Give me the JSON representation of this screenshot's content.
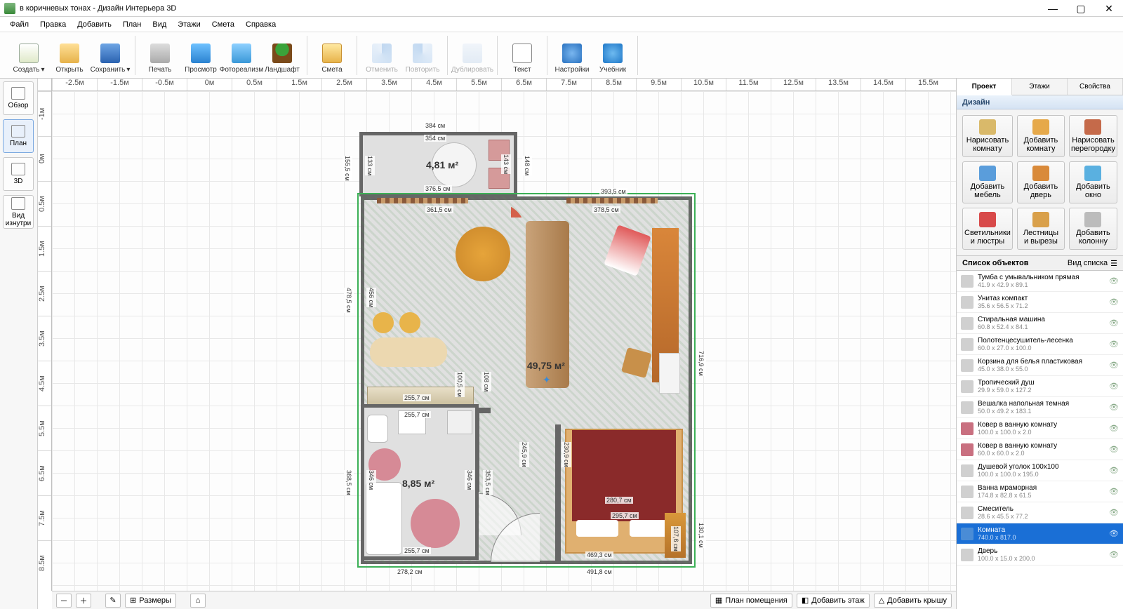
{
  "title": "в коричневых тонах - Дизайн Интерьера 3D",
  "window_controls": {
    "min": "—",
    "max": "▢",
    "close": "✕"
  },
  "menubar": [
    "Файл",
    "Правка",
    "Добавить",
    "План",
    "Вид",
    "Этажи",
    "Смета",
    "Справка"
  ],
  "toolbar": [
    {
      "id": "create",
      "label": "Создать",
      "icon": "ic-new",
      "arrow": true
    },
    {
      "id": "open",
      "label": "Открыть",
      "icon": "ic-open"
    },
    {
      "id": "save",
      "label": "Сохранить",
      "icon": "ic-save",
      "arrow": true
    },
    {
      "sep": true
    },
    {
      "id": "print",
      "label": "Печать",
      "icon": "ic-print"
    },
    {
      "id": "preview",
      "label": "Просмотр",
      "icon": "ic-view"
    },
    {
      "id": "photoreal",
      "label": "Фотореализм",
      "icon": "ic-photo"
    },
    {
      "id": "landscape",
      "label": "Ландшафт",
      "icon": "ic-land"
    },
    {
      "sep": true
    },
    {
      "id": "smeta",
      "label": "Смета",
      "icon": "ic-smeta"
    },
    {
      "sep": true
    },
    {
      "id": "undo",
      "label": "Отменить",
      "icon": "ic-undo",
      "disabled": true
    },
    {
      "id": "redo",
      "label": "Повторить",
      "icon": "ic-redo",
      "disabled": true
    },
    {
      "sep": true
    },
    {
      "id": "dup",
      "label": "Дублировать",
      "icon": "ic-dup",
      "disabled": true
    },
    {
      "sep": true
    },
    {
      "id": "text",
      "label": "Текст",
      "icon": "ic-text"
    },
    {
      "sep": true
    },
    {
      "id": "settings",
      "label": "Настройки",
      "icon": "ic-set"
    },
    {
      "id": "tutorial",
      "label": "Учебник",
      "icon": "ic-help"
    }
  ],
  "lefttabs": [
    {
      "id": "obzor",
      "label": "Обзор"
    },
    {
      "id": "plan",
      "label": "План",
      "selected": true
    },
    {
      "id": "3d",
      "label": "3D"
    },
    {
      "id": "inside",
      "label": "Вид\nизнутри"
    }
  ],
  "ruler_h": [
    "-2.5м",
    "-1.5м",
    "-0.5м",
    "0м",
    "0.5м",
    "1.5м",
    "2.5м",
    "3.5м",
    "4.5м",
    "5.5м",
    "6.5м",
    "7.5м",
    "8.5м",
    "9.5м",
    "10.5м",
    "11.5м",
    "12.5м",
    "13.5м",
    "14.5м",
    "15.5м"
  ],
  "ruler_v": [
    "-1м",
    "0м",
    "0.5м",
    "1.5м",
    "2.5м",
    "3.5м",
    "4.5м",
    "5.5м",
    "6.5м",
    "7.5м",
    "8.5м"
  ],
  "plan": {
    "room_small": {
      "area": "4,81 м²",
      "dims": {
        "top_out": "384 см",
        "top_in": "354 см",
        "bottom_in": "376,5 см",
        "left_out": "155,5 см",
        "left_in": "133 см",
        "right_in": "148 см",
        "right_r": "143 см"
      }
    },
    "room_main": {
      "area": "49,75 м²",
      "dims": {
        "top_r": "393,5 см",
        "right_out": "716,9 см",
        "left_out": "478,5 см",
        "left_in": "456 см",
        "mid_l": "108 см",
        "mid_lh": "100,5 см",
        "win_left": "361,5 см",
        "win_right": "378,5 см",
        "bot_right": "295,7 см",
        "bot_right2": "469,3 см",
        "bot_out": "491,8 см",
        "right_in": "107,6 см",
        "right_in2": "130,1 см",
        "bed_w": "280,7 см",
        "door_h": "245,9 см",
        "door_h2": "230,9 см",
        "kitch": "255,7 см"
      }
    },
    "room_bath": {
      "area": "8,85 м²",
      "dims": {
        "top": "255,7 см",
        "left_out": "368,5 см",
        "left_in": "346 см",
        "right1": "346 см",
        "right2": "353,5 см",
        "bottom": "255,7 см",
        "bottom_out": "278,2 см"
      }
    }
  },
  "statusbar": {
    "zoom_out": "－",
    "zoom_in": "＋",
    "pencil": "✎",
    "sizes": "Размеры",
    "home": "⌂",
    "btn1": "План помещения",
    "btn2": "Добавить этаж",
    "btn3": "Добавить крышу"
  },
  "rightpanel": {
    "tabs": [
      "Проект",
      "Этажи",
      "Свойства"
    ],
    "active_tab": 0,
    "design_header": "Дизайн",
    "design_buttons": [
      {
        "label": "Нарисовать\nкомнату",
        "col": "#d9b96a"
      },
      {
        "label": "Добавить\nкомнату",
        "col": "#e6a94a"
      },
      {
        "label": "Нарисовать\nперегородку",
        "col": "#c56a4a"
      },
      {
        "label": "Добавить\nмебель",
        "col": "#5a9ddb"
      },
      {
        "label": "Добавить\nдверь",
        "col": "#d98a3a"
      },
      {
        "label": "Добавить\nокно",
        "col": "#5ab0e0"
      },
      {
        "label": "Светильники\nи люстры",
        "col": "#d84a4a"
      },
      {
        "label": "Лестницы\nи вырезы",
        "col": "#d9a04a"
      },
      {
        "label": "Добавить\nколонну",
        "col": "#bcbcbc"
      }
    ],
    "objlist_header": "Список объектов",
    "list_view_label": "Вид списка",
    "objects": [
      {
        "name": "Тумба с умывальником прямая",
        "size": "41.9 x 42.9 x 89.1"
      },
      {
        "name": "Унитаз компакт",
        "size": "35.6 x 56.5 x 71.2"
      },
      {
        "name": "Стиральная машина",
        "size": "60.8 x 52.4 x 84.1"
      },
      {
        "name": "Полотенцесушитель-лесенка",
        "size": "60.0 x 27.0 x 100.0"
      },
      {
        "name": "Корзина для белья пластиковая",
        "size": "45.0 x 38.0 x 55.0"
      },
      {
        "name": "Тропический душ",
        "size": "29.9 x 59.0 x 127.2"
      },
      {
        "name": "Вешалка напольная темная",
        "size": "50.0 x 49.2 x 183.1"
      },
      {
        "name": "Ковер в ванную комнату",
        "size": "100.0 x 100.0 x 2.0",
        "col": "#c97080"
      },
      {
        "name": "Ковер в ванную комнату",
        "size": "60.0 x 60.0 x 2.0",
        "col": "#c97080"
      },
      {
        "name": "Душевой уголок 100x100",
        "size": "100.0 x 100.0 x 195.0"
      },
      {
        "name": "Ванна мраморная",
        "size": "174.8 x 82.8 x 61.5"
      },
      {
        "name": "Смеситель",
        "size": "28.6 x 45.5 x 77.2"
      },
      {
        "name": "Комната",
        "size": "740.0 x 817.0",
        "selected": true,
        "col": "#4a8cd6"
      },
      {
        "name": "Дверь",
        "size": "100.0 x 15.0 x 200.0"
      }
    ]
  }
}
